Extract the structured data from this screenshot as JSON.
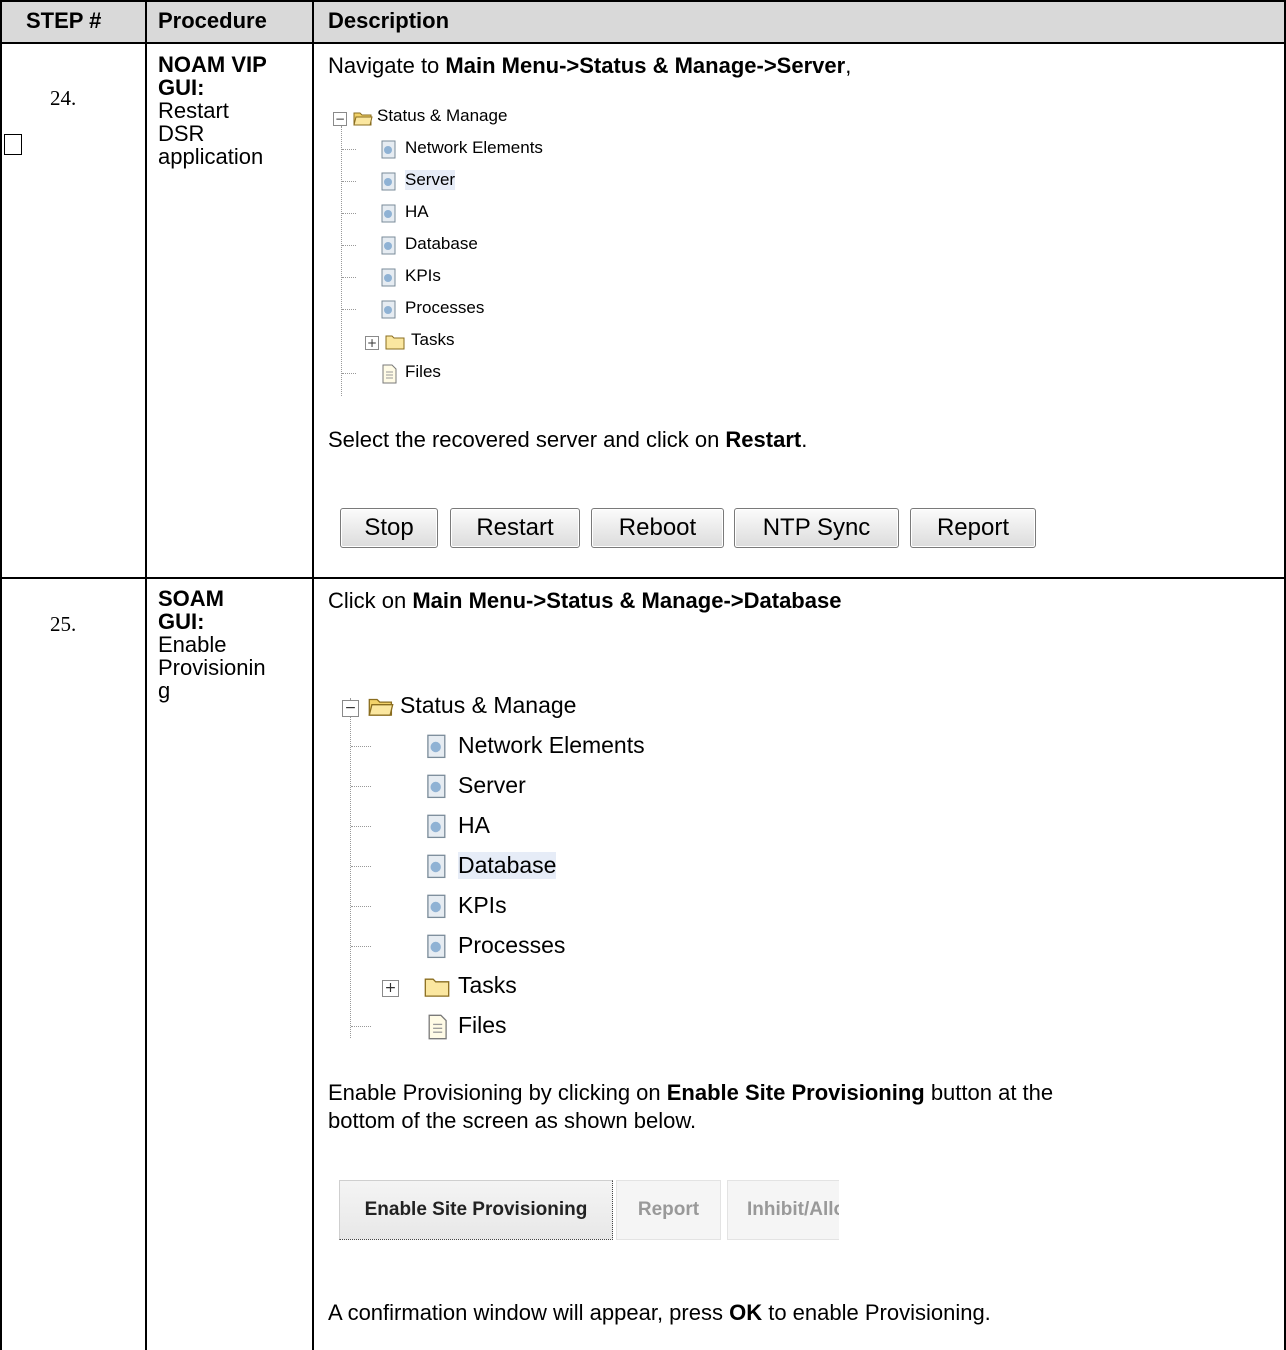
{
  "header": {
    "step": "STEP #",
    "procedure": "Procedure",
    "description": "Description"
  },
  "rows": [
    {
      "step": "24.",
      "procedure_bold": [
        "NOAM VIP",
        "GUI:"
      ],
      "procedure_normal": [
        "Restart",
        "DSR",
        "application"
      ],
      "nav_prefix": "Navigate to ",
      "nav_bold": "Main Menu->Status & Manage->Server",
      "nav_suffix": ",",
      "tree": {
        "root": "Status & Manage",
        "items": [
          "Network Elements",
          "Server",
          "HA",
          "Database",
          "KPIs",
          "Processes",
          "Tasks",
          "Files"
        ],
        "selected": "Server"
      },
      "instr_prefix": "Select the recovered server and click on ",
      "instr_bold": "Restart",
      "instr_suffix": ".",
      "buttons": [
        "Stop",
        "Restart",
        "Reboot",
        "NTP Sync",
        "Report"
      ]
    },
    {
      "step": "25.",
      "procedure_bold": [
        "SOAM",
        "GUI:"
      ],
      "procedure_normal": [
        "Enable",
        "Provisionin",
        "g"
      ],
      "nav_prefix": "Click on ",
      "nav_bold": "Main Menu->Status & Manage->Database",
      "tree": {
        "root": "Status & Manage",
        "items": [
          "Network Elements",
          "Server",
          "HA",
          "Database",
          "KPIs",
          "Processes",
          "Tasks",
          "Files"
        ],
        "selected": "Database"
      },
      "instr_prefix": "Enable Provisioning by clicking on ",
      "instr_bold": "Enable Site Provisioning",
      "instr_suffix": " button at the",
      "instr_line2": "bottom of the screen as shown below.",
      "buttons": [
        "Enable Site Provisioning",
        "Report",
        "Inhibit/Allo"
      ],
      "confirm_prefix": "A confirmation window will appear, press ",
      "confirm_bold": "OK",
      "confirm_suffix": " to enable Provisioning."
    }
  ]
}
